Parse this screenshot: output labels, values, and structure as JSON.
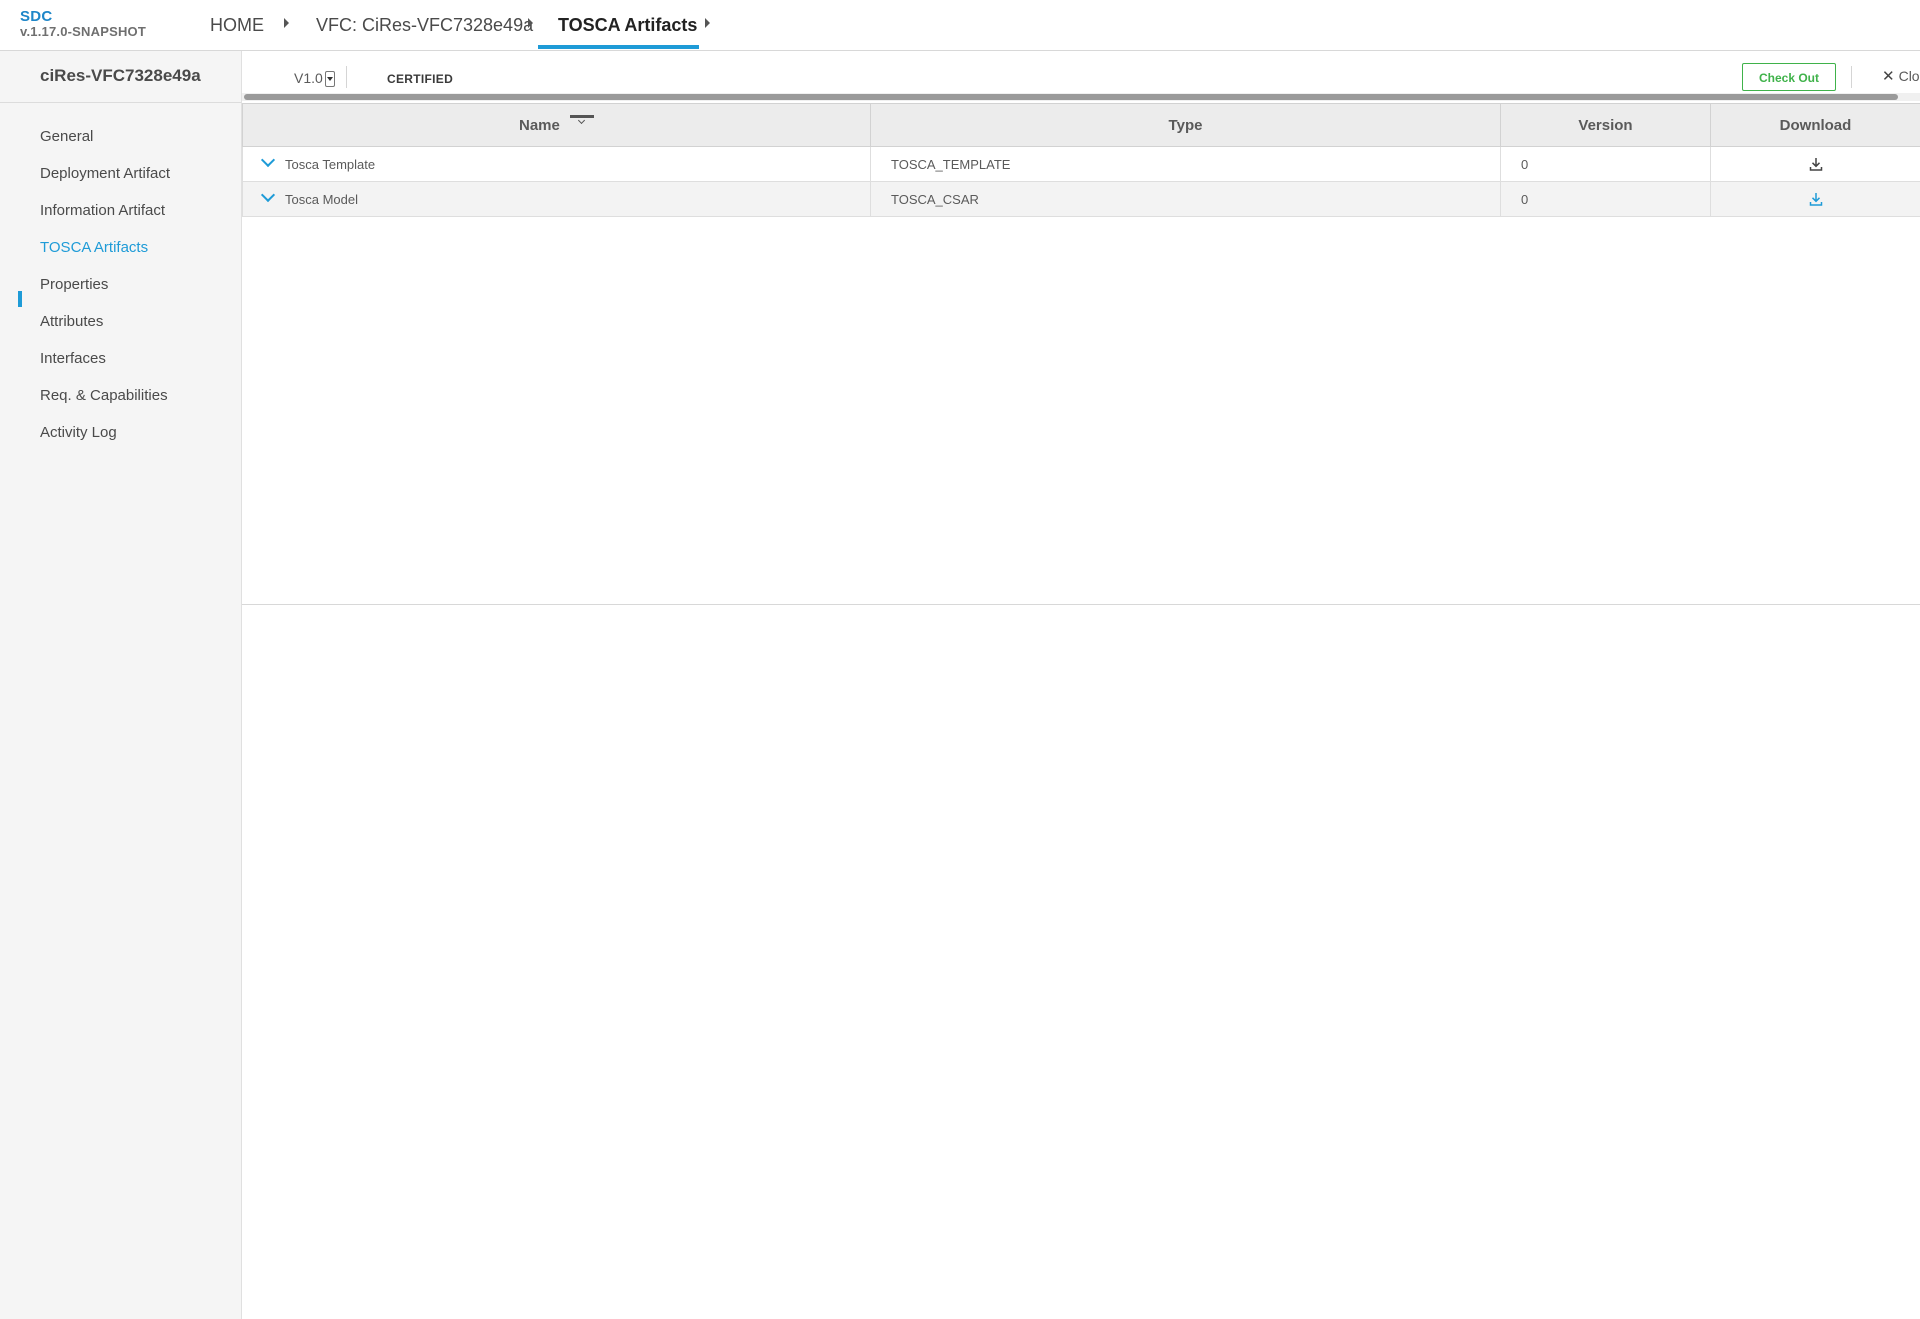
{
  "header": {
    "brand": "SDC",
    "version": "v.1.17.0-SNAPSHOT",
    "breadcrumbs": [
      {
        "label": "HOME"
      },
      {
        "label": "VFC: CiRes-VFC7328e49a"
      },
      {
        "label": "TOSCA Artifacts"
      }
    ]
  },
  "sidebar": {
    "title": "ciRes-VFC7328e49a",
    "items": [
      {
        "label": "General"
      },
      {
        "label": "Deployment Artifact"
      },
      {
        "label": "Information Artifact"
      },
      {
        "label": "TOSCA Artifacts",
        "active": true
      },
      {
        "label": "Properties"
      },
      {
        "label": "Attributes"
      },
      {
        "label": "Interfaces"
      },
      {
        "label": "Req. & Capabilities"
      },
      {
        "label": "Activity Log"
      }
    ]
  },
  "workspace": {
    "version": "V1.0",
    "status": "CERTIFIED",
    "checkout_label": "Check Out",
    "close_label": "Clo"
  },
  "table": {
    "columns": [
      "Name",
      "Type",
      "Version",
      "Download"
    ],
    "rows": [
      {
        "name": "Tosca Template",
        "type": "TOSCA_TEMPLATE",
        "version": "0",
        "download_icon_color": "#444444"
      },
      {
        "name": "Tosca Model",
        "type": "TOSCA_CSAR",
        "version": "0",
        "download_icon_color": "#1e9bd7"
      }
    ]
  },
  "colors": {
    "accent": "#1e9bd7",
    "brand": "#1e86c8",
    "checkout": "#3fb24a"
  }
}
